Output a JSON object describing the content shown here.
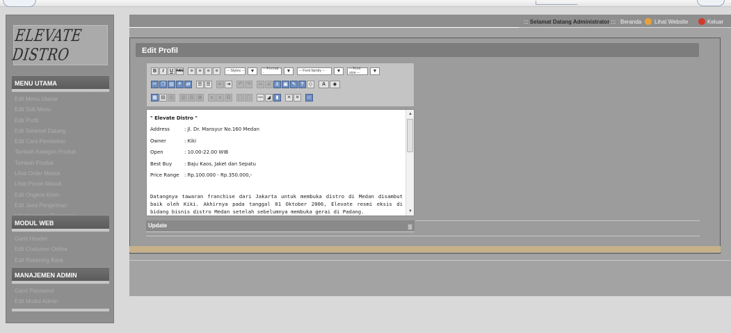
{
  "sidebar": {
    "logo_text": "ELEVATE DISTRO",
    "sections": [
      {
        "header": "MENU UTAMA",
        "items": [
          "Edit Menu Utama",
          "Edit Sub Menu",
          "Edit Profil",
          "Edit Selamat Datang",
          "Edit Cara Pembelian",
          "Tambah Kategori Produk",
          "Tambah Produk",
          "Lihat Order Masuk",
          "Lihat Pesan Masuk",
          "Edit Ongkos Kirim",
          "Edit Jasa Pengiriman",
          "Lihat Laporan Transaksi"
        ]
      },
      {
        "header": "MODUL WEB",
        "items": [
          "Ganti Header",
          "Edit Costumer Online",
          "Edit Rekening Bank"
        ]
      },
      {
        "header": "MANAJEMEN ADMIN",
        "items": [
          "Ganti Password",
          "Edit Modul Admin"
        ]
      }
    ]
  },
  "header": {
    "welcome_prefix": ":::",
    "welcome_text": "Selamat Datang Administrator",
    "welcome_suffix": ":::",
    "links": {
      "home": "Beranda",
      "website": "Lihat Website",
      "logout": "Keluar"
    },
    "colors": {
      "website_icon": "#e8a23b",
      "logout_icon": "#d23b2c"
    }
  },
  "main": {
    "title": "Edit Profil",
    "editor": {
      "toolbar": {
        "row1_buttons": [
          "B",
          "I",
          "U",
          "ABC"
        ],
        "selects": [
          "-- Styles --",
          "-- Format --",
          "-- Font family --",
          "-- Font size --"
        ]
      },
      "content": {
        "title_line": "\" Elevate Distro \"",
        "fields": [
          {
            "label": "Address",
            "value": ": Jl. Dr. Mansyur No.160 Medan"
          },
          {
            "label": "Owner",
            "value": ": Kiki"
          },
          {
            "label": "Open",
            "value": ": 10.00-22.00 WIB"
          },
          {
            "label": "Best Buy",
            "value": ": Baju Kaos, Jaket dan Sepatu"
          },
          {
            "label": "Price Range",
            "value": ": Rp.100.000 - Rp.350.000,-"
          }
        ],
        "paragraph": "Datangnya tawaran franchise dari Jakarta untuk membuka distro di Medan disambut baik oleh Kiki. Akhirnya pada tanggal 01 Oktober 2006, Elevate resmi eksis di bidang bisnis distro Medan setelah sebelumnya membuka gerai di Padang."
      },
      "update_label": "Update"
    }
  }
}
